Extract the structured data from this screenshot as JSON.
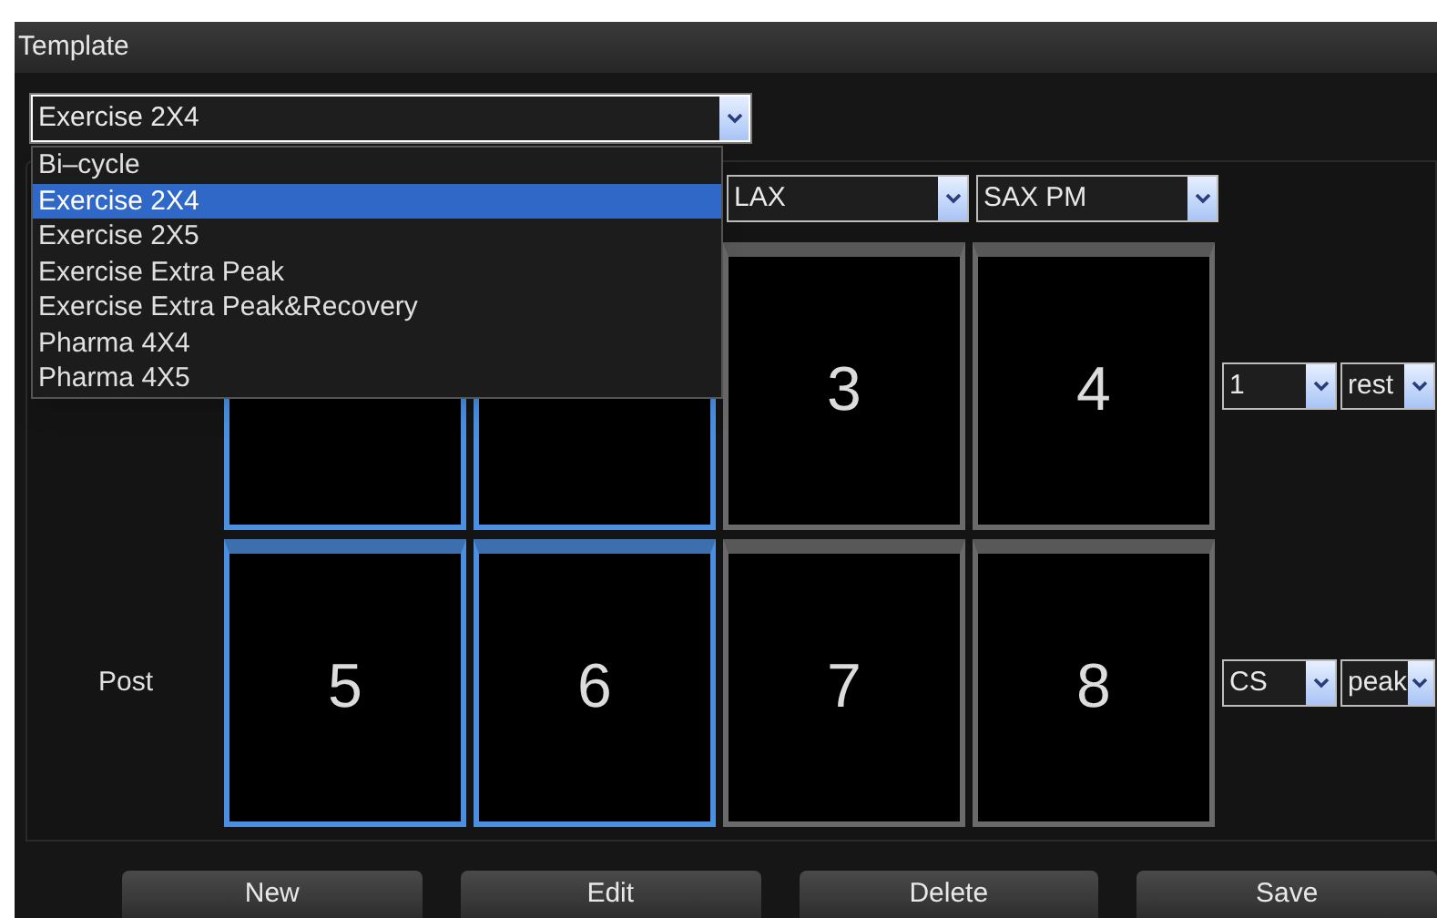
{
  "window": {
    "title": "Template"
  },
  "template_select": {
    "value": "Exercise 2X4",
    "expanded": true,
    "options": [
      {
        "label": "Bi–cycle",
        "selected": false
      },
      {
        "label": "Exercise 2X4",
        "selected": true
      },
      {
        "label": "Exercise 2X5",
        "selected": false
      },
      {
        "label": "Exercise Extra Peak",
        "selected": false
      },
      {
        "label": "Exercise Extra Peak&Recovery",
        "selected": false
      },
      {
        "label": "Pharma 4X4",
        "selected": false
      },
      {
        "label": "Pharma 4X5",
        "selected": false
      }
    ]
  },
  "columns": [
    {},
    {},
    {
      "select": "LAX"
    },
    {
      "select": "SAX PM"
    }
  ],
  "rows": [
    {
      "tiles": [
        {
          "selected": true
        },
        {
          "selected": true
        },
        {
          "number": "3",
          "selected": false
        },
        {
          "number": "4",
          "selected": false
        }
      ],
      "selects": [
        "1",
        "rest"
      ]
    },
    {
      "label": "Post",
      "tiles": [
        {
          "number": "5",
          "selected": true
        },
        {
          "number": "6",
          "selected": true
        },
        {
          "number": "7",
          "selected": false
        },
        {
          "number": "8",
          "selected": false
        }
      ],
      "selects": [
        "CS",
        "peak"
      ]
    }
  ],
  "buttons": [
    "New",
    "Edit",
    "Delete",
    "Save"
  ]
}
